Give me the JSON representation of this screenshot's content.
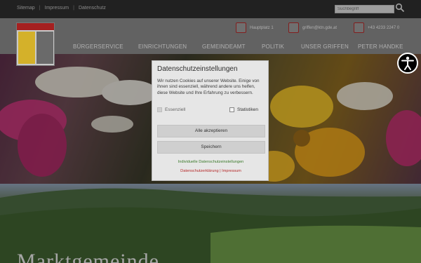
{
  "topbar": {
    "links": [
      "Sitemap",
      "Impressum",
      "Datenschutz"
    ],
    "search_placeholder": "Suchbegriff"
  },
  "header": {
    "contacts": [
      {
        "icon": "map-pin-icon",
        "text": "Hauptplatz 1"
      },
      {
        "icon": "mail-icon",
        "text": "griffen@ktn.gde.at"
      },
      {
        "icon": "phone-icon",
        "text": "+43 4233 2247 0"
      }
    ],
    "nav": [
      "BÜRGERSERVICE",
      "EINRICHTUNGEN",
      "GEMEINDEAMT",
      "POLITIK",
      "UNSER GRIFFEN",
      "PETER HANDKE"
    ]
  },
  "hero": {
    "title": "Marktgemeinde"
  },
  "dialog": {
    "title": "Datenschutzeinstellungen",
    "text": "Wir nutzen Cookies auf unserer Website. Einige von ihnen sind essenziell, während andere uns helfen, diese Website und Ihre Erfahrung zu verbessern.",
    "essential_label": "Essenziell",
    "stats_label": "Statistiken",
    "accept_all": "Alle akzeptieren",
    "save": "Speichern",
    "individual": "Individuelle Datenschutzeinstellungen",
    "privacy": "Datenschutzerklärung",
    "imprint": "Impressum",
    "link_color": "#3a7a2a",
    "privacy_color": "#b52a2a"
  }
}
